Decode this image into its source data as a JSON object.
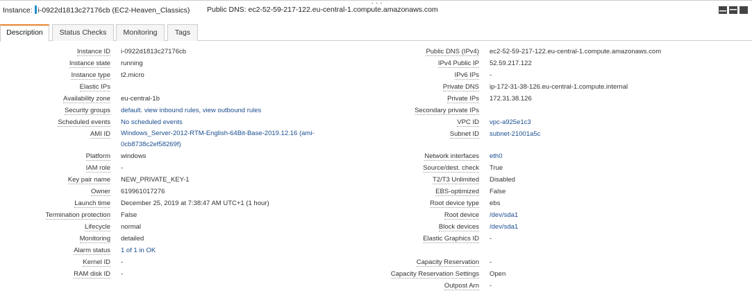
{
  "header": {
    "instance_label": "Instance:",
    "instance_value": "i-0922d1813c27176cb (EC2-Heaven_Classics)",
    "public_dns_label": "Public DNS:",
    "public_dns_value": "ec2-52-59-217-122.eu-central-1.compute.amazonaws.com"
  },
  "tabs": [
    "Description",
    "Status Checks",
    "Monitoring",
    "Tags"
  ],
  "left": [
    {
      "label": "Instance ID",
      "value": "i-0922d1813c27176cb"
    },
    {
      "label": "Instance state",
      "value": "running"
    },
    {
      "label": "Instance type",
      "value": "t2.micro"
    },
    {
      "label": "Elastic IPs",
      "value": ""
    },
    {
      "label": "Availability zone",
      "value": "eu-central-1b"
    },
    {
      "label": "Security groups",
      "value": "",
      "links": [
        "default",
        "view inbound rules",
        "view outbound rules"
      ]
    },
    {
      "label": "Scheduled events",
      "value": "No scheduled events",
      "link": true
    },
    {
      "label": "AMI ID",
      "value": "Windows_Server-2012-RTM-English-64Bit-Base-2019.12.16 (ami-",
      "value2": "0cb8738c2ef58269f)",
      "link": true
    },
    {
      "label": "Platform",
      "value": "windows"
    },
    {
      "label": "IAM role",
      "value": "-"
    },
    {
      "label": "Key pair name",
      "value": "NEW_PRIVATE_KEY-1"
    },
    {
      "label": "Owner",
      "value": "619961017276"
    },
    {
      "label": "Launch time",
      "value": "December 25, 2019 at 7:38:47 AM UTC+1 (1 hour)"
    },
    {
      "label": "Termination protection",
      "value": "False"
    },
    {
      "label": "Lifecycle",
      "value": "normal"
    },
    {
      "label": "Monitoring",
      "value": "detailed"
    },
    {
      "label": "Alarm status",
      "value": "1 of 1 in OK",
      "link": true
    },
    {
      "label": "Kernel ID",
      "value": "-"
    },
    {
      "label": "RAM disk ID",
      "value": "-"
    }
  ],
  "right": [
    {
      "label": "Public DNS (IPv4)",
      "value": "ec2-52-59-217-122.eu-central-1.compute.amazonaws.com"
    },
    {
      "label": "IPv4 Public IP",
      "value": "52.59.217.122"
    },
    {
      "label": "IPv6 IPs",
      "value": "-"
    },
    {
      "label": "Private DNS",
      "value": "ip-172-31-38-126.eu-central-1.compute.internal"
    },
    {
      "label": "Private IPs",
      "value": "172.31.38.126"
    },
    {
      "label": "Secondary private IPs",
      "value": ""
    },
    {
      "label": "VPC ID",
      "value": "vpc-a925e1c3",
      "link": true
    },
    {
      "label": "Subnet ID",
      "value": "subnet-21001a5c",
      "link": true
    },
    {
      "label": "Network interfaces",
      "value": "eth0",
      "link": true
    },
    {
      "label": "Source/dest. check",
      "value": "True"
    },
    {
      "label": "T2/T3 Unlimited",
      "value": "Disabled"
    },
    {
      "label": "EBS-optimized",
      "value": "False"
    },
    {
      "label": "Root device type",
      "value": "ebs"
    },
    {
      "label": "Root device",
      "value": "/dev/sda1",
      "link": true
    },
    {
      "label": "Block devices",
      "value": "/dev/sda1",
      "link": true
    },
    {
      "label": "Elastic Graphics ID",
      "value": "-"
    },
    {
      "label": "Capacity Reservation",
      "value": "-"
    },
    {
      "label": "Capacity Reservation Settings",
      "value": "Open"
    },
    {
      "label": "Outpost Arn",
      "value": "-"
    }
  ],
  "icons": [
    "layout-bottom-icon",
    "layout-split-icon",
    "layout-full-icon"
  ]
}
